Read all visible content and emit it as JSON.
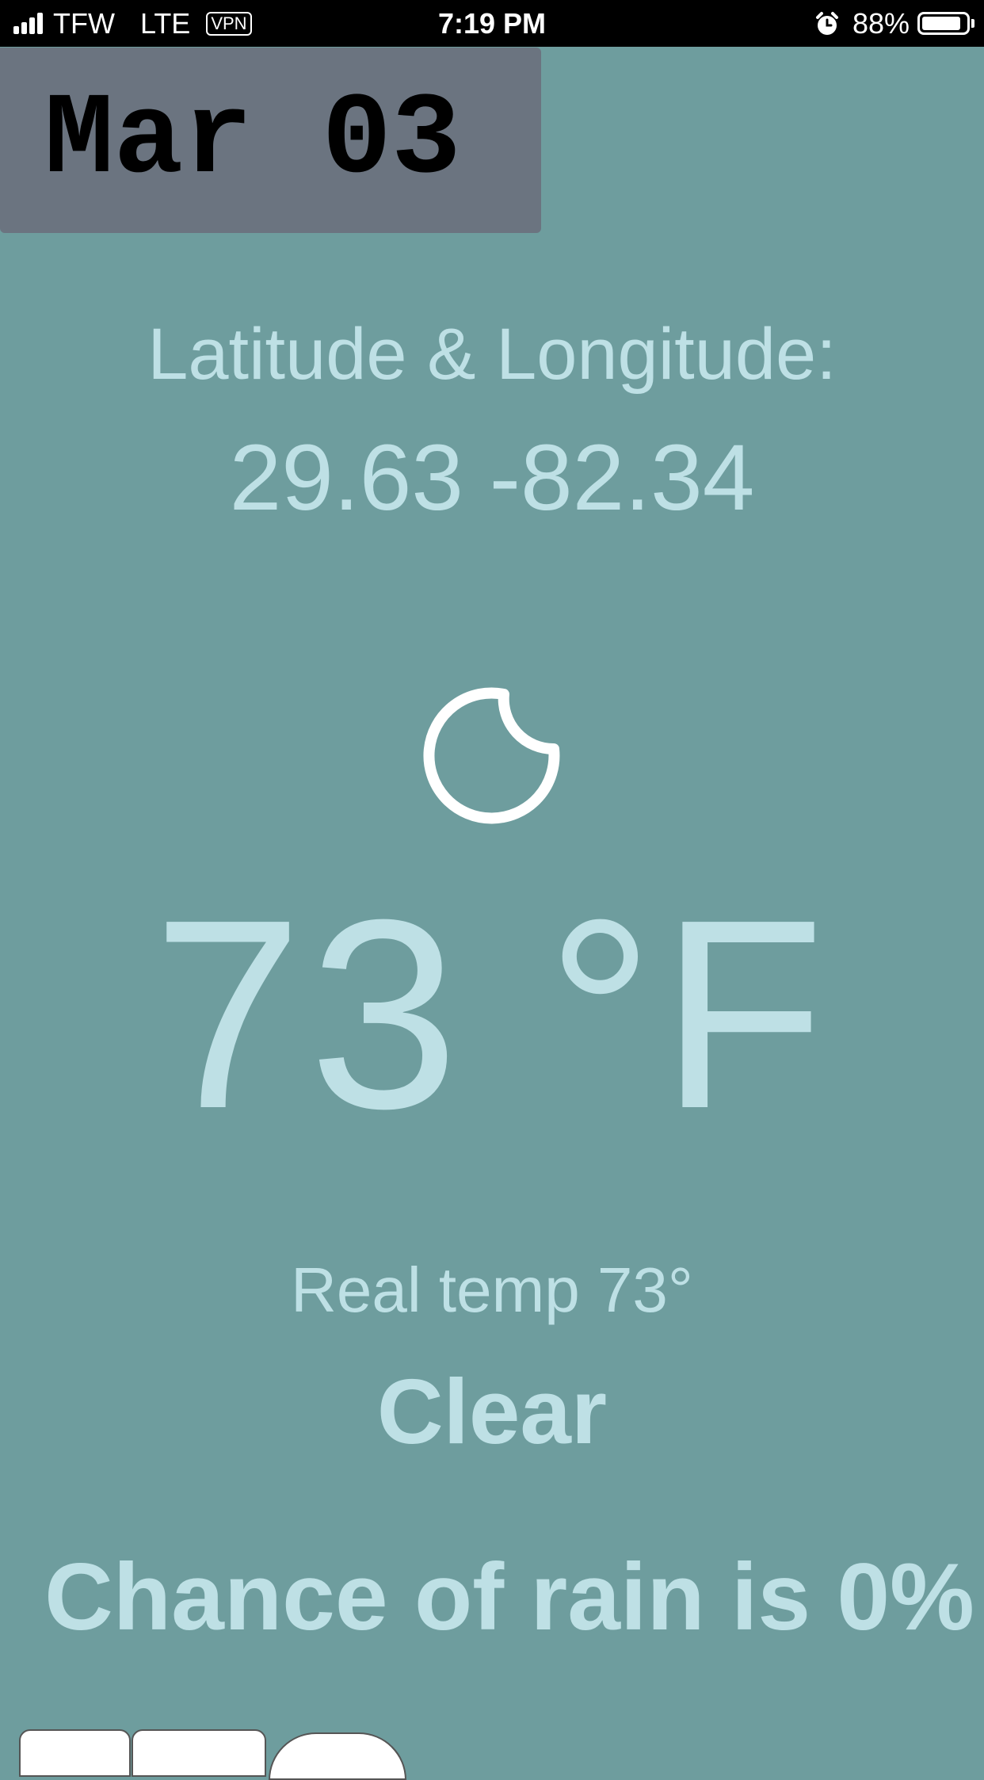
{
  "status_bar": {
    "carrier": "TFW",
    "network": "LTE",
    "vpn": "VPN",
    "time": "7:19 PM",
    "battery_percent": "88%",
    "battery_level": 0.88,
    "icons": [
      "signal-icon",
      "alarm-icon",
      "battery-icon"
    ]
  },
  "date": "Mar 03",
  "location": {
    "label": "Latitude & Longitude:",
    "value": "29.63 -82.34"
  },
  "weather": {
    "icon": "moon-icon",
    "temperature": "73 °F",
    "real_temp": "Real temp 73°",
    "condition": "Clear",
    "rain_chance": "Chance of rain is 0%"
  },
  "colors": {
    "background": "#6e9d9e",
    "date_box": "#6b7480",
    "text": "#bee0e5"
  }
}
